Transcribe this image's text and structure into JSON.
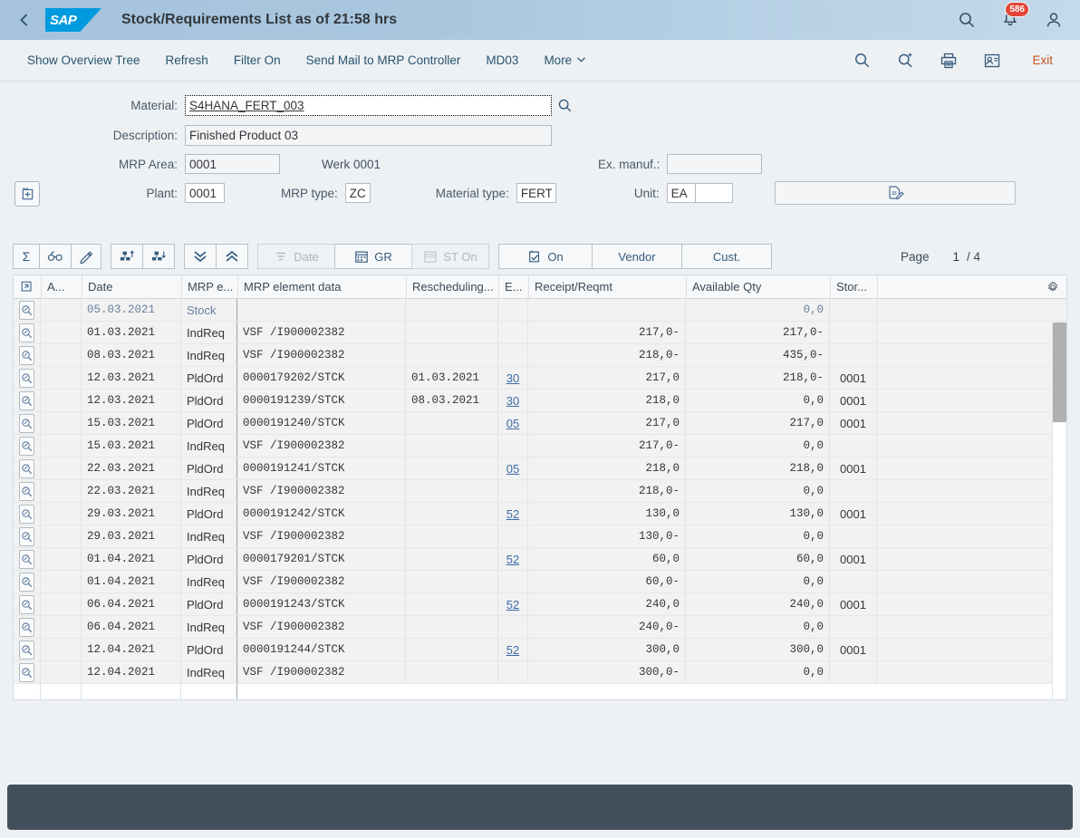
{
  "shell": {
    "title": "Stock/Requirements List as of 21:58 hrs",
    "logo_text": "SAP",
    "back_label": "Back",
    "notification_count": "586"
  },
  "toolbar": {
    "items": [
      {
        "label": "Show Overview Tree"
      },
      {
        "label": "Refresh"
      },
      {
        "label": "Filter On"
      },
      {
        "label": "Send Mail to MRP Controller"
      },
      {
        "label": "MD03"
      },
      {
        "label": "More"
      }
    ],
    "exit_label": "Exit"
  },
  "form": {
    "material_label": "Material:",
    "material_value": "S4HANA_FERT_003",
    "description_label": "Description:",
    "description_value": "Finished Product 03",
    "mrp_area_label": "MRP Area:",
    "mrp_area_value": "0001",
    "mrp_area_text": "Werk 0001",
    "plant_label": "Plant:",
    "plant_value": "0001",
    "mrp_type_label": "MRP type:",
    "mrp_type_value": "ZC",
    "material_type_label": "Material type:",
    "material_type_value": "FERT",
    "ex_manuf_label": "Ex. manuf.:",
    "ex_manuf_value": "",
    "unit_label": "Unit:",
    "unit_value": "EA",
    "unit_value2": ""
  },
  "table_toolbar": {
    "buttons": [
      {
        "label": "",
        "icon": "sigma-icon",
        "disabled": false
      },
      {
        "label": "",
        "icon": "glasses-icon",
        "disabled": false
      },
      {
        "label": "",
        "icon": "pencil-icon",
        "disabled": false
      },
      {
        "label": "",
        "icon": "hierarchy-up-icon",
        "disabled": false
      },
      {
        "label": "",
        "icon": "hierarchy-down-icon",
        "disabled": false
      },
      {
        "label": "",
        "icon": "double-chevron-down-icon",
        "disabled": false
      },
      {
        "label": "",
        "icon": "double-chevron-up-icon",
        "disabled": false
      },
      {
        "label": "Date",
        "icon": "sort-icon",
        "disabled": true
      },
      {
        "label": "GR",
        "icon": "calendar-icon",
        "disabled": false
      },
      {
        "label": "ST On",
        "icon": "calendar-icon",
        "disabled": true
      },
      {
        "label": "On",
        "icon": "calendar-check-icon",
        "disabled": false
      },
      {
        "label": "Vendor",
        "icon": "",
        "disabled": false
      },
      {
        "label": "Cust.",
        "icon": "",
        "disabled": false
      }
    ],
    "page_label": "Page",
    "page_current": "1",
    "page_total": "/ 4"
  },
  "grid": {
    "columns": [
      {
        "label": "A...",
        "key": "a"
      },
      {
        "label": "Date",
        "key": "date"
      },
      {
        "label": "MRP e...",
        "key": "mrp_element"
      },
      {
        "label": "MRP element data",
        "key": "mrp_element_data"
      },
      {
        "label": "Rescheduling...",
        "key": "rescheduling"
      },
      {
        "label": "E...",
        "key": "e"
      },
      {
        "label": "Receipt/Reqmt",
        "key": "receipt"
      },
      {
        "label": "Available Qty",
        "key": "available"
      },
      {
        "label": "Stor...",
        "key": "storage"
      },
      {
        "label": "",
        "key": "blank"
      }
    ],
    "rows": [
      {
        "date": "05.03.2021",
        "mrp_element": "Stock",
        "mrp_element_data": "",
        "rescheduling": "",
        "e": "",
        "receipt": "",
        "available": "0,0",
        "storage": "",
        "stock": true
      },
      {
        "date": "01.03.2021",
        "mrp_element": "IndReq",
        "mrp_element_data": "VSF  /I900002382",
        "rescheduling": "",
        "e": "",
        "receipt": "217,0-",
        "available": "217,0-",
        "storage": ""
      },
      {
        "date": "08.03.2021",
        "mrp_element": "IndReq",
        "mrp_element_data": "VSF  /I900002382",
        "rescheduling": "",
        "e": "",
        "receipt": "218,0-",
        "available": "435,0-",
        "storage": ""
      },
      {
        "date": "12.03.2021",
        "mrp_element": "PldOrd",
        "mrp_element_data": "0000179202/STCK",
        "rescheduling": "01.03.2021",
        "e": "30",
        "receipt": "217,0",
        "available": "218,0-",
        "storage": "0001"
      },
      {
        "date": "12.03.2021",
        "mrp_element": "PldOrd",
        "mrp_element_data": "0000191239/STCK",
        "rescheduling": "08.03.2021",
        "e": "30",
        "receipt": "218,0",
        "available": "0,0",
        "storage": "0001"
      },
      {
        "date": "15.03.2021",
        "mrp_element": "PldOrd",
        "mrp_element_data": "0000191240/STCK",
        "rescheduling": "",
        "e": "05",
        "receipt": "217,0",
        "available": "217,0",
        "storage": "0001"
      },
      {
        "date": "15.03.2021",
        "mrp_element": "IndReq",
        "mrp_element_data": "VSF  /I900002382",
        "rescheduling": "",
        "e": "",
        "receipt": "217,0-",
        "available": "0,0",
        "storage": ""
      },
      {
        "date": "22.03.2021",
        "mrp_element": "PldOrd",
        "mrp_element_data": "0000191241/STCK",
        "rescheduling": "",
        "e": "05",
        "receipt": "218,0",
        "available": "218,0",
        "storage": "0001"
      },
      {
        "date": "22.03.2021",
        "mrp_element": "IndReq",
        "mrp_element_data": "VSF  /I900002382",
        "rescheduling": "",
        "e": "",
        "receipt": "218,0-",
        "available": "0,0",
        "storage": ""
      },
      {
        "date": "29.03.2021",
        "mrp_element": "PldOrd",
        "mrp_element_data": "0000191242/STCK",
        "rescheduling": "",
        "e": "52",
        "receipt": "130,0",
        "available": "130,0",
        "storage": "0001"
      },
      {
        "date": "29.03.2021",
        "mrp_element": "IndReq",
        "mrp_element_data": "VSF  /I900002382",
        "rescheduling": "",
        "e": "",
        "receipt": "130,0-",
        "available": "0,0",
        "storage": ""
      },
      {
        "date": "01.04.2021",
        "mrp_element": "PldOrd",
        "mrp_element_data": "0000179201/STCK",
        "rescheduling": "",
        "e": "52",
        "receipt": "60,0",
        "available": "60,0",
        "storage": "0001"
      },
      {
        "date": "01.04.2021",
        "mrp_element": "IndReq",
        "mrp_element_data": "VSF  /I900002382",
        "rescheduling": "",
        "e": "",
        "receipt": "60,0-",
        "available": "0,0",
        "storage": ""
      },
      {
        "date": "06.04.2021",
        "mrp_element": "PldOrd",
        "mrp_element_data": "0000191243/STCK",
        "rescheduling": "",
        "e": "52",
        "receipt": "240,0",
        "available": "240,0",
        "storage": "0001"
      },
      {
        "date": "06.04.2021",
        "mrp_element": "IndReq",
        "mrp_element_data": "VSF  /I900002382",
        "rescheduling": "",
        "e": "",
        "receipt": "240,0-",
        "available": "0,0",
        "storage": ""
      },
      {
        "date": "12.04.2021",
        "mrp_element": "PldOrd",
        "mrp_element_data": "0000191244/STCK",
        "rescheduling": "",
        "e": "52",
        "receipt": "300,0",
        "available": "300,0",
        "storage": "0001"
      },
      {
        "date": "12.04.2021",
        "mrp_element": "IndReq",
        "mrp_element_data": "VSF  /I900002382",
        "rescheduling": "",
        "e": "",
        "receipt": "300,0-",
        "available": "0,0",
        "storage": ""
      }
    ]
  },
  "colors": {
    "accent": "#009ade",
    "badge": "#e4453a",
    "exit": "#c2571f",
    "link": "#3c6ba5",
    "footer": "#42505c"
  }
}
